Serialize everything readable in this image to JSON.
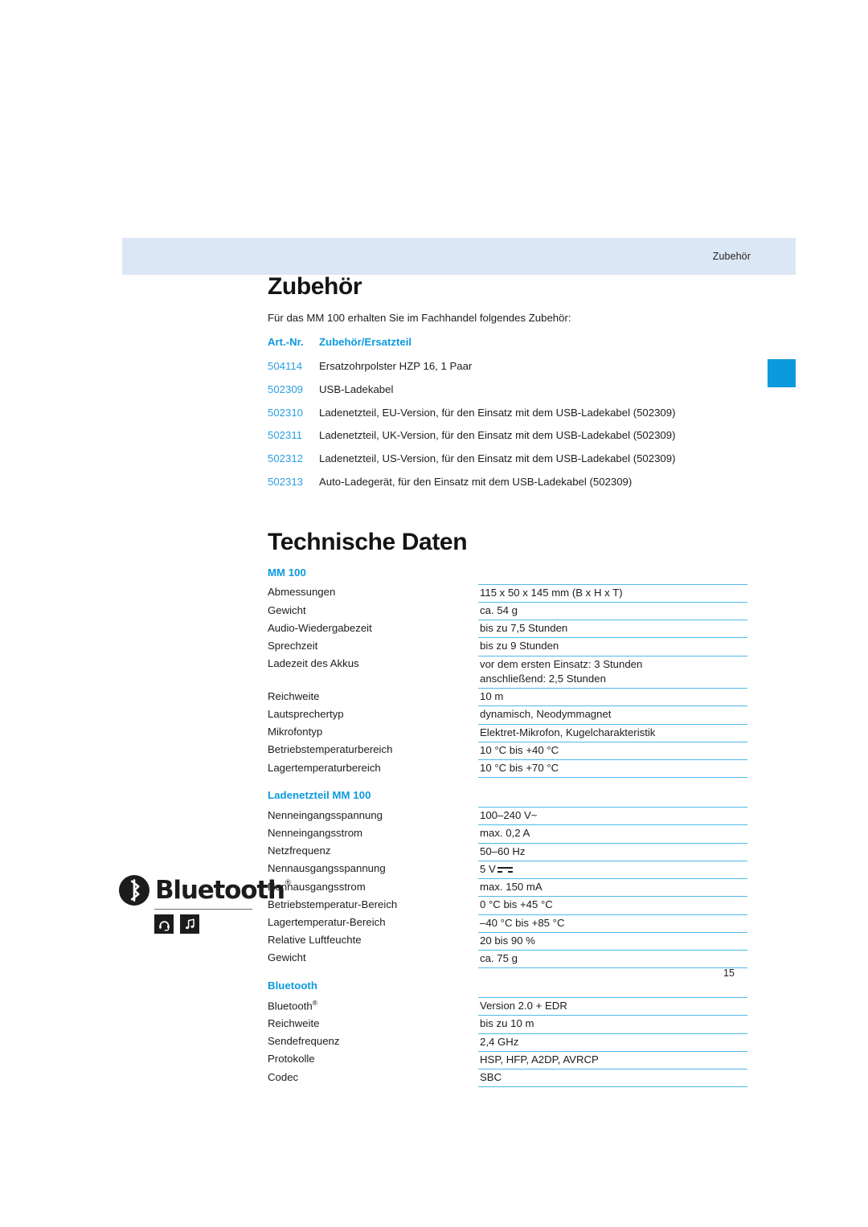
{
  "header": {
    "running_head": "Zubehör"
  },
  "edge_tab": {
    "color": "#0b9ade"
  },
  "chapters": {
    "accessories_title": "Zubehör",
    "accessories_intro": "Für das MM 100 erhalten Sie im Fachhandel folgendes Zubehör:",
    "tech_title": "Technische Daten"
  },
  "accessories_table": {
    "columns": [
      "Art.-Nr.",
      "Zubehör/Ersatzteil"
    ],
    "rows": [
      {
        "art_nr": "504114",
        "desc": "Ersatzohrpolster HZP 16, 1 Paar"
      },
      {
        "art_nr": "502309",
        "desc": "USB-Ladekabel"
      },
      {
        "art_nr": "502310",
        "desc": "Ladenetzteil, EU-Version, für den Einsatz mit dem USB-Ladekabel (502309)"
      },
      {
        "art_nr": "502311",
        "desc": "Ladenetzteil, UK-Version, für den Einsatz mit dem USB-Ladekabel (502309)"
      },
      {
        "art_nr": "502312",
        "desc": "Ladenetzteil, US-Version, für den Einsatz mit dem USB-Ladekabel (502309)"
      },
      {
        "art_nr": "502313",
        "desc": "Auto-Ladegerät, für den Einsatz mit dem USB-Ladekabel (502309)"
      }
    ]
  },
  "spec_sections": {
    "mm100": {
      "heading": "MM 100",
      "rows": [
        {
          "label": "Abmessungen",
          "value": "115 x 50 x 145 mm (B x H x T)"
        },
        {
          "label": "Gewicht",
          "value": "ca. 54 g"
        },
        {
          "label": "Audio-Wiedergabezeit",
          "value": "bis zu 7,5 Stunden"
        },
        {
          "label": "Sprechzeit",
          "value": "bis zu 9 Stunden"
        },
        {
          "label": "Ladezeit des Akkus",
          "value": "vor dem ersten Einsatz: 3 Stunden",
          "value2": "anschließend: 2,5 Stunden"
        },
        {
          "label": "Reichweite",
          "value": "10 m"
        },
        {
          "label": "Lautsprechertyp",
          "value": "dynamisch, Neodymmagnet"
        },
        {
          "label": "Mikrofontyp",
          "value": "Elektret-Mikrofon, Kugelcharakteristik"
        },
        {
          "label": "Betriebstemperaturbereich",
          "value": "10 °C bis +40 °C"
        },
        {
          "label": "Lagertemperaturbereich",
          "value": "10 °C bis +70 °C"
        }
      ]
    },
    "psu": {
      "heading": "Ladenetzteil MM 100",
      "rows": [
        {
          "label": "Nenneingangsspannung",
          "value": "100–240 V~"
        },
        {
          "label": "Nenneingangsstrom",
          "value": "max. 0,2 A"
        },
        {
          "label": "Netzfrequenz",
          "value": "50–60 Hz"
        },
        {
          "label": "Nennausgangsspannung",
          "value": "5 V",
          "symbol": "dc-symbol"
        },
        {
          "label": "Nennausgangsstrom",
          "value": "max. 150 mA"
        },
        {
          "label": "Betriebstemperatur-Bereich",
          "value": "0 °C bis +45 °C"
        },
        {
          "label": "Lagertemperatur-Bereich",
          "value": "–40 °C bis +85 °C"
        },
        {
          "label": "Relative Luftfeuchte",
          "value": "20 bis 90 %"
        },
        {
          "label": "Gewicht",
          "value": "ca. 75 g"
        }
      ]
    },
    "bluetooth": {
      "heading": "Bluetooth",
      "rows": [
        {
          "label": "Bluetooth",
          "label_sup": "®",
          "value": "Version 2.0 + EDR"
        },
        {
          "label": "Reichweite",
          "value": "bis zu 10 m"
        },
        {
          "label": "Sendefrequenz",
          "value": "2,4 GHz"
        },
        {
          "label": "Protokolle",
          "value": "HSP, HFP, A2DP, AVRCP"
        },
        {
          "label": "Codec",
          "value": "SBC"
        }
      ]
    }
  },
  "bluetooth_logo": {
    "wordmark": "Bluetooth",
    "registered": "®",
    "icons": [
      "headset-icon",
      "music-note-icon"
    ]
  },
  "footer": {
    "page_number": "15"
  }
}
